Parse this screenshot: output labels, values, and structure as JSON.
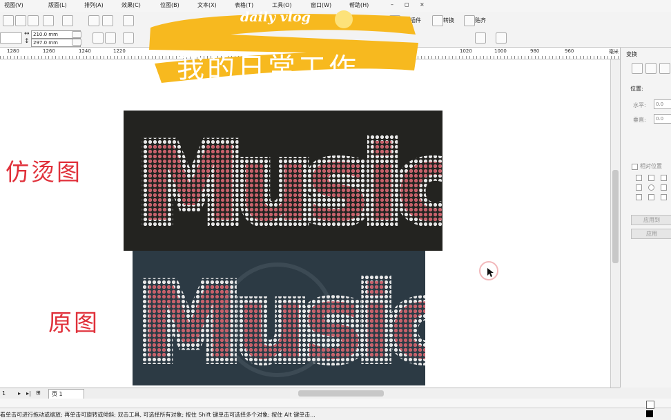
{
  "menu": {
    "items": [
      "视图(V)",
      "版面(L)",
      "排列(A)",
      "效果(C)",
      "位图(B)",
      "文本(X)",
      "表格(T)",
      "工具(O)",
      "窗口(W)",
      "帮助(H)"
    ],
    "window_controls": [
      "–",
      "◻",
      "×"
    ]
  },
  "toolbar": {
    "plugin_label": "漂插插件",
    "convert_label": "转换",
    "paste_label": "贴齐"
  },
  "page_size": {
    "width": "210.0 mm",
    "height": "297.0 mm"
  },
  "ruler": {
    "ticks": [
      "1280",
      "1260",
      "1240",
      "1220",
      "1020",
      "1000",
      "980",
      "960"
    ],
    "corner": "毫米"
  },
  "docker": {
    "title": "变换",
    "position_label": "位置:",
    "horizontal_label": "水平:",
    "horizontal_value": "0.0",
    "vertical_label": "垂直:",
    "vertical_value": "0.0",
    "relative_label": "相对位置",
    "apply_to_copy": "应用到",
    "apply": "应用"
  },
  "pager": {
    "page_number": "1",
    "page_tab": "页 1"
  },
  "status": {
    "text": "看单击可进行拖动或缩放; 再单击可旋转或倾斜; 双击工具, 可选择所有对象; 按住 Shift 键单击可选择多个对象; 按住 Alt 键单击..."
  },
  "overlay": {
    "banner_sub": "daily vlog",
    "banner_title": "我的日常工作",
    "label_top": "仿烫图",
    "label_bottom": "原图"
  },
  "artwork": {
    "word_top": "Music",
    "word_bottom": "Music"
  },
  "colors": {
    "banner_yellow": "#f7b91f",
    "annotation_red": "#e0303a",
    "image_top_bg": "#232320",
    "image_bottom_bg": "#2c3a44",
    "rhinestone_pink": "#c8606a",
    "rhinestone_white": "#e8e8e8"
  }
}
